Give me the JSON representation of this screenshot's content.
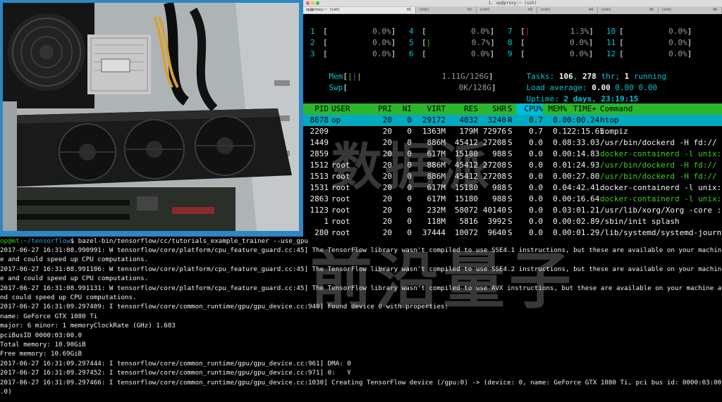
{
  "window": {
    "title": "1. op@proxy:~ (ssh)",
    "tabs": [
      {
        "label": "op@proxy:~ (ssh)",
        "shortcut": "⌘1",
        "active": true
      },
      {
        "label": "(zsh)",
        "shortcut": "⌘2",
        "active": false
      },
      {
        "label": "(zsh)",
        "shortcut": "⌘3",
        "active": false
      },
      {
        "label": "(zsh)",
        "shortcut": "⌘4",
        "active": false
      },
      {
        "label": "(zsh)",
        "shortcut": "⌘5",
        "active": false
      },
      {
        "label": "(zsh)",
        "shortcut": "⌘6",
        "active": false
      }
    ]
  },
  "htop": {
    "cpu": [
      {
        "id": "1",
        "pct": "0.0%"
      },
      {
        "id": "2",
        "pct": "0.0%"
      },
      {
        "id": "3",
        "pct": "0.0%"
      },
      {
        "id": "4",
        "pct": "0.0%"
      },
      {
        "id": "5",
        "pct": "0.7%"
      },
      {
        "id": "6",
        "pct": "0.0%"
      },
      {
        "id": "7",
        "pct": "1.3%"
      },
      {
        "id": "8",
        "pct": "0.0%"
      },
      {
        "id": "9",
        "pct": "0.0%"
      },
      {
        "id": "10",
        "pct": "0.0%"
      },
      {
        "id": "11",
        "pct": "0.0%"
      },
      {
        "id": "12",
        "pct": "0.0%"
      }
    ],
    "mem": {
      "label": "Mem",
      "value": "1.11G/126G"
    },
    "swp": {
      "label": "Swp",
      "value": "0K/128G"
    },
    "tasks": {
      "label": "Tasks:",
      "count": "106",
      "thr": "278",
      "thr_label": "thr;",
      "running": "1",
      "running_label": "running"
    },
    "load": {
      "label": "Load average:",
      "v1": "0.00",
      "v2": "0.00",
      "v3": "0.00"
    },
    "uptime": {
      "label": "Uptime:",
      "value": "2 days, 23:19:15"
    },
    "columns": {
      "pid": "PID",
      "user": "USER",
      "pri": "PRI",
      "ni": "NI",
      "virt": "VIRT",
      "res": "RES",
      "shr": "SHR",
      "s": "S",
      "cpu": "CPU%",
      "mem": "MEM%",
      "time": "TIME+",
      "cmd": "Command"
    },
    "processes": [
      {
        "pid": "8678",
        "user": "op",
        "pri": "20",
        "ni": "0",
        "virt": "29172",
        "res": "4032",
        "shr": "3240",
        "s": "R",
        "cpu": "0.7",
        "mem": "0.0",
        "time": "0:00.24",
        "cmd": "htop",
        "selected": true,
        "green": false
      },
      {
        "pid": "2209",
        "user": "",
        "pri": "20",
        "ni": "0",
        "virt": "1363M",
        "res": "179M",
        "shr": "72976",
        "s": "S",
        "cpu": "0.7",
        "mem": "0.1",
        "time": "22:15.65",
        "cmd": "compiz",
        "selected": false,
        "green": false
      },
      {
        "pid": "1449",
        "user": "",
        "pri": "20",
        "ni": "0",
        "virt": "886M",
        "res": "45412",
        "shr": "27208",
        "s": "S",
        "cpu": "0.0",
        "mem": "0.0",
        "time": "8:33.03",
        "cmd": "/usr/bin/dockerd -H fd://",
        "selected": false,
        "green": false
      },
      {
        "pid": "2859",
        "user": "",
        "pri": "20",
        "ni": "0",
        "virt": "617M",
        "res": "15180",
        "shr": "988",
        "s": "S",
        "cpu": "0.0",
        "mem": "0.0",
        "time": "0:14.83",
        "cmd": "docker-containerd -l unix:",
        "selected": false,
        "green": true
      },
      {
        "pid": "1512",
        "user": "root",
        "pri": "20",
        "ni": "0",
        "virt": "886M",
        "res": "45412",
        "shr": "27208",
        "s": "S",
        "cpu": "0.0",
        "mem": "0.0",
        "time": "1:24.93",
        "cmd": "/usr/bin/dockerd -H fd://",
        "selected": false,
        "green": true
      },
      {
        "pid": "1513",
        "user": "root",
        "pri": "20",
        "ni": "0",
        "virt": "886M",
        "res": "45412",
        "shr": "27208",
        "s": "S",
        "cpu": "0.0",
        "mem": "0.0",
        "time": "0:27.80",
        "cmd": "/usr/bin/dockerd -H fd://",
        "selected": false,
        "green": true
      },
      {
        "pid": "1531",
        "user": "root",
        "pri": "20",
        "ni": "0",
        "virt": "617M",
        "res": "15180",
        "shr": "988",
        "s": "S",
        "cpu": "0.0",
        "mem": "0.0",
        "time": "4:42.41",
        "cmd": "docker-containerd -l unix:",
        "selected": false,
        "green": false
      },
      {
        "pid": "2863",
        "user": "root",
        "pri": "20",
        "ni": "0",
        "virt": "617M",
        "res": "15180",
        "shr": "988",
        "s": "S",
        "cpu": "0.0",
        "mem": "0.0",
        "time": "0:16.64",
        "cmd": "docker-containerd -l unix:",
        "selected": false,
        "green": true
      },
      {
        "pid": "1123",
        "user": "root",
        "pri": "20",
        "ni": "0",
        "virt": "232M",
        "res": "58072",
        "shr": "40140",
        "s": "S",
        "cpu": "0.0",
        "mem": "0.0",
        "time": "3:01.21",
        "cmd": "/usr/lib/xorg/Xorg -core :",
        "selected": false,
        "green": false
      },
      {
        "pid": "1",
        "user": "root",
        "pri": "20",
        "ni": "0",
        "virt": "118M",
        "res": "5816",
        "shr": "3992",
        "s": "S",
        "cpu": "0.0",
        "mem": "0.0",
        "time": "0:02.89",
        "cmd": "/sbin/init splash",
        "selected": false,
        "green": false
      },
      {
        "pid": "280",
        "user": "root",
        "pri": "20",
        "ni": "0",
        "virt": "37444",
        "res": "10072",
        "shr": "9640",
        "s": "S",
        "cpu": "0.0",
        "mem": "0.0",
        "time": "0:01.29",
        "cmd": "/lib/systemd/systemd-journ",
        "selected": false,
        "green": false
      }
    ]
  },
  "terminal": {
    "prompt_user": "op@mt",
    "prompt_path": ":~/tensorflow",
    "prompt_sym": "$",
    "command": " bazel-bin/tensorflow/cc/tutorials_example_trainer --use_gpu",
    "lines": [
      "2017-06-27 16:31:08.990991: W tensorflow/core/platform/cpu_feature_guard.cc:45] The TensorFlow library wasn't compiled to use SSE4.1 instructions, but these are available on your machin",
      "e and could speed up CPU computations.",
      "2017-06-27 16:31:08.991106: W tensorflow/core/platform/cpu_feature_guard.cc:45] The TensorFlow library wasn't compiled to use SSE4.2 instructions, but these are available on your machin",
      "e and could speed up CPU computations.",
      "2017-06-27 16:31:08.991131: W tensorflow/core/platform/cpu_feature_guard.cc:45] The TensorFlow library wasn't compiled to use AVX instructions, but these are available on your machine a",
      "nd could speed up CPU computations.",
      "2017-06-27 16:31:09.297409: I tensorflow/core/common_runtime/gpu/gpu_device.cc:940] Found device 0 with properties:",
      "name: GeForce GTX 1080 Ti",
      "major: 6 minor: 1 memoryClockRate (GHz) 1.683",
      "pciBusID 0000:03:00.0",
      "Total memory: 10.90GiB",
      "Free memory: 10.69GiB",
      "2017-06-27 16:31:09.297444: I tensorflow/core/common_runtime/gpu/gpu_device.cc:961] DMA: 0",
      "2017-06-27 16:31:09.297452: I tensorflow/core/common_runtime/gpu/gpu_device.cc:971] 0:   Y",
      "2017-06-27 16:31:09.297466: I tensorflow/core/common_runtime/gpu/gpu_device.cc:1030] Creating TensorFlow device (/gpu:0) -> (device: 0, name: GeForce GTX 1080 Ti, pci bus id: 0000:03:00",
      ".0)"
    ]
  },
  "watermark": {
    "line1": "数据派",
    "line2": "前沿量子"
  },
  "colors": {
    "accent_green": "#39d11c",
    "accent_cyan": "#00c6d4",
    "header_green": "#2db52d",
    "photo_border": "#2d86c6"
  }
}
